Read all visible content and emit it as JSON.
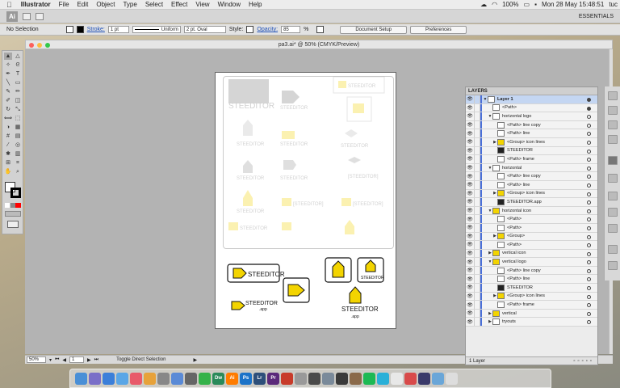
{
  "menubar": {
    "app_name": "Illustrator",
    "items": [
      "File",
      "Edit",
      "Object",
      "Type",
      "Select",
      "Effect",
      "View",
      "Window",
      "Help"
    ],
    "battery": "100%",
    "datetime": "Mon 28 May  15:48:51",
    "user": "tuc"
  },
  "appbar": {
    "logo": "Ai",
    "workspace": "ESSENTIALS"
  },
  "control_bar": {
    "selection": "No Selection",
    "stroke_label": "Stroke:",
    "stroke_value": "1 pt",
    "profile": "Uniform",
    "brush": "2 pt. Oval",
    "style_label": "Style:",
    "opacity_label": "Opacity:",
    "opacity_value": "85",
    "opacity_unit": "%",
    "document_setup": "Document Setup",
    "preferences": "Preferences"
  },
  "document": {
    "title": "pa3.ai* @ 50% (CMYK/Preview)"
  },
  "status_bar": {
    "zoom": "50%",
    "artboard": "1",
    "tool": "Toggle Direct Selection"
  },
  "layers_panel": {
    "tab": "LAYERS",
    "count": "1 Layer",
    "rows": [
      {
        "label": "Layer 1",
        "indent": 0,
        "expand": "▼",
        "thumb": "w",
        "active": true,
        "target": "filled"
      },
      {
        "label": "<Path>",
        "indent": 1,
        "expand": "",
        "thumb": "w",
        "target": "filled"
      },
      {
        "label": "horizontal logo",
        "indent": 1,
        "expand": "▼",
        "thumb": "w",
        "target": "o"
      },
      {
        "label": "<Path> line copy",
        "indent": 2,
        "expand": "",
        "thumb": "w",
        "target": "o"
      },
      {
        "label": "<Path> line",
        "indent": 2,
        "expand": "",
        "thumb": "w",
        "target": "o"
      },
      {
        "label": "<Group> icon lines",
        "indent": 2,
        "expand": "▶",
        "thumb": "y",
        "target": "o"
      },
      {
        "label": "STEEDITOR",
        "indent": 2,
        "expand": "",
        "thumb": "k",
        "target": "o"
      },
      {
        "label": "<Path> frame",
        "indent": 2,
        "expand": "",
        "thumb": "w",
        "target": "o"
      },
      {
        "label": "horizontal",
        "indent": 1,
        "expand": "▼",
        "thumb": "w",
        "target": "o"
      },
      {
        "label": "<Path> line copy",
        "indent": 2,
        "expand": "",
        "thumb": "w",
        "target": "o"
      },
      {
        "label": "<Path> line",
        "indent": 2,
        "expand": "",
        "thumb": "w",
        "target": "o"
      },
      {
        "label": "<Group> icon lines",
        "indent": 2,
        "expand": "▶",
        "thumb": "y",
        "target": "o"
      },
      {
        "label": "STEEDITOR.app",
        "indent": 2,
        "expand": "",
        "thumb": "k",
        "target": "o"
      },
      {
        "label": "horizontal icon",
        "indent": 1,
        "expand": "▼",
        "thumb": "y",
        "target": "o"
      },
      {
        "label": "<Path>",
        "indent": 2,
        "expand": "",
        "thumb": "w",
        "target": "o"
      },
      {
        "label": "<Path>",
        "indent": 2,
        "expand": "",
        "thumb": "w",
        "target": "o"
      },
      {
        "label": "<Group>",
        "indent": 2,
        "expand": "▶",
        "thumb": "y",
        "target": "o"
      },
      {
        "label": "<Path>",
        "indent": 2,
        "expand": "",
        "thumb": "w",
        "target": "o"
      },
      {
        "label": "vertical icon",
        "indent": 1,
        "expand": "▶",
        "thumb": "y",
        "target": "o"
      },
      {
        "label": "vertical logo",
        "indent": 1,
        "expand": "▼",
        "thumb": "y",
        "target": "o"
      },
      {
        "label": "<Path> line copy",
        "indent": 2,
        "expand": "",
        "thumb": "w",
        "target": "o"
      },
      {
        "label": "<Path> line",
        "indent": 2,
        "expand": "",
        "thumb": "w",
        "target": "o"
      },
      {
        "label": "STEEDITOR",
        "indent": 2,
        "expand": "",
        "thumb": "k",
        "target": "o"
      },
      {
        "label": "<Group> icon lines",
        "indent": 2,
        "expand": "▶",
        "thumb": "y",
        "target": "o"
      },
      {
        "label": "<Path> frame",
        "indent": 2,
        "expand": "",
        "thumb": "w",
        "target": "o"
      },
      {
        "label": "vertical",
        "indent": 1,
        "expand": "▶",
        "thumb": "y",
        "target": "o"
      },
      {
        "label": "tryouts",
        "indent": 1,
        "expand": "▶",
        "thumb": "w",
        "target": "o"
      }
    ]
  },
  "artwork": {
    "brand": "STEEDITOR",
    "brand_bracket": "[STEEDITOR]",
    "app_suffix": ".app",
    "accent": "#f3d400"
  },
  "dock": {
    "labels": [
      "Dw",
      "Ai",
      "Ps",
      "Lr",
      "Pr"
    ]
  }
}
